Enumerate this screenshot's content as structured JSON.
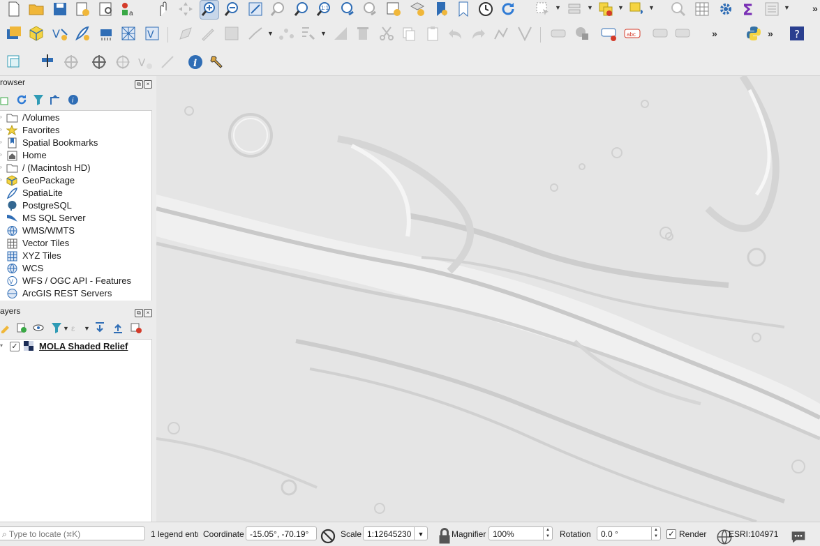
{
  "toolbars": {
    "row1_overflow": "»",
    "row2_overflow_1": "»",
    "row2_overflow_2": "»",
    "label_tool_text": "abc"
  },
  "browser": {
    "title": "rowser",
    "items": [
      {
        "label": "/Volumes",
        "icon": "folder-icon"
      },
      {
        "label": "Favorites",
        "icon": "star-icon"
      },
      {
        "label": "Spatial Bookmarks",
        "icon": "bookmark-icon"
      },
      {
        "label": "Home",
        "icon": "home-icon"
      },
      {
        "label": "/ (Macintosh HD)",
        "icon": "folder-icon"
      },
      {
        "label": "GeoPackage",
        "icon": "geopackage-icon"
      },
      {
        "label": "SpatiaLite",
        "icon": "spatialite-icon"
      },
      {
        "label": "PostgreSQL",
        "icon": "postgresql-icon"
      },
      {
        "label": "MS SQL Server",
        "icon": "mssql-icon"
      },
      {
        "label": "WMS/WMTS",
        "icon": "globe-icon"
      },
      {
        "label": "Vector Tiles",
        "icon": "grid-icon"
      },
      {
        "label": "XYZ Tiles",
        "icon": "grid-icon"
      },
      {
        "label": "WCS",
        "icon": "globe-icon"
      },
      {
        "label": "WFS / OGC API - Features",
        "icon": "globe-icon"
      },
      {
        "label": "ArcGIS REST Servers",
        "icon": "globe-icon"
      }
    ]
  },
  "layers": {
    "title": "ayers",
    "items": [
      {
        "label": "MOLA Shaded Relief",
        "checked": true
      }
    ]
  },
  "statusbar": {
    "locator_placeholder": "Type to locate (⌘K)",
    "legend_text": "1 legend entı",
    "coordinate_label": "Coordinate",
    "coordinate_value": "-15.05°, -70.19°",
    "scale_label": "Scale",
    "scale_value": "1:12645230",
    "magnifier_label": "Magnifier",
    "magnifier_value": "100%",
    "rotation_label": "Rotation",
    "rotation_value": "0.0 °",
    "render_label": "Render",
    "render_checked": true,
    "crs_value": "ESRI:104971"
  },
  "colors": {
    "map_bg": "#e4e4e4",
    "accent_blue": "#2f7bd5",
    "chrome": "#ececec"
  }
}
